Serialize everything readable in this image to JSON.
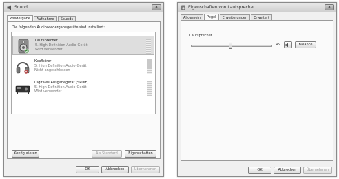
{
  "sound_dialog": {
    "title": "Sound",
    "tabs": [
      {
        "label": "Wiedergabe",
        "active": true
      },
      {
        "label": "Aufnahme",
        "active": false
      },
      {
        "label": "Sounds",
        "active": false
      }
    ],
    "instruction": "Die folgenden Audiowiedergabegeräte sind installiert:",
    "devices": [
      {
        "name": "Lautsprecher",
        "description": "5. High Definition Audio-Gerät",
        "status": "Wird verwendet",
        "icon": "speaker-icon",
        "selected": true
      },
      {
        "name": "Kopfhörer",
        "description": "5. High Definition Audio-Gerät",
        "status": "Nicht angeschlossen",
        "icon": "headphones-icon",
        "selected": false
      },
      {
        "name": "Digitales Ausgabegerät (SPDIF)",
        "description": "5. High Definition Audio-Gerät",
        "status": "Wird verwendet",
        "icon": "spdif-output-icon",
        "selected": false
      }
    ],
    "buttons": {
      "configure": "Konfigurieren",
      "set_default": "Als Standard",
      "properties": "Eigenschaften",
      "ok": "OK",
      "cancel": "Abbrechen",
      "apply": "Übernehmen"
    }
  },
  "properties_dialog": {
    "title": "Eigenschaften von Lautsprecher",
    "tabs": [
      {
        "label": "Allgemein",
        "active": false
      },
      {
        "label": "Pegel",
        "active": true
      },
      {
        "label": "Erweiterungen",
        "active": false
      },
      {
        "label": "Erweitert",
        "active": false
      }
    ],
    "level_group_label": "Lautsprecher",
    "volume_value": "49",
    "volume_fraction": 0.49,
    "balance_button": "Balance",
    "buttons": {
      "ok": "OK",
      "cancel": "Abbrechen",
      "apply": "Übernehmen"
    }
  }
}
